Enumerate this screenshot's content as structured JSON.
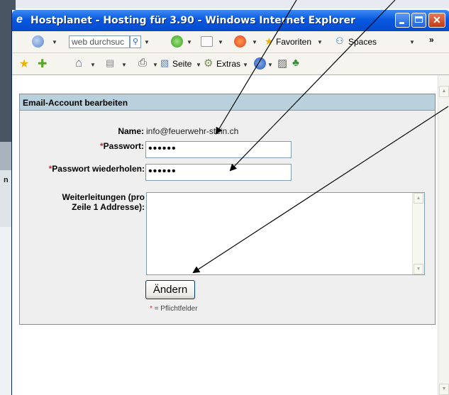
{
  "window": {
    "title": "Hostplanet - Hosting für 3.90 - Windows Internet Explorer"
  },
  "toolbar1": {
    "search_placeholder": "web durchsuc",
    "favorites_label": "Favoriten",
    "spaces_label": "Spaces",
    "overflow": "»"
  },
  "toolbar2": {
    "page_label": "Seite",
    "extras_label": "Extras"
  },
  "background": {
    "partial_letter": "n"
  },
  "form": {
    "header": "Email-Account bearbeiten",
    "name_label": "Name:",
    "name_value": "info@feuerwehr-stein.ch",
    "password_label": "Passwort:",
    "password_value": "••••••",
    "password_repeat_label": "Passwort wiederholen:",
    "password_repeat_value": "••••••",
    "forward_label_line1": "Weiterleitungen (pro",
    "forward_label_line2": "Zeile 1 Addresse):",
    "forward_value": "",
    "required_mark": "*",
    "submit_label": "Ändern",
    "required_note": "= Pflichtfelder"
  },
  "colors": {
    "titlebar": "#0958e0",
    "panel_header": "#b9d1dc",
    "required": "#d9272e"
  },
  "icons": [
    "ie-logo-icon",
    "back-icon",
    "search-go-icon",
    "add-icon",
    "favorites-star-icon",
    "spaces-icon",
    "home-icon",
    "feeds-icon",
    "print-icon",
    "page-icon",
    "extras-gear-icon",
    "help-icon",
    "research-icon",
    "messenger-icon"
  ]
}
